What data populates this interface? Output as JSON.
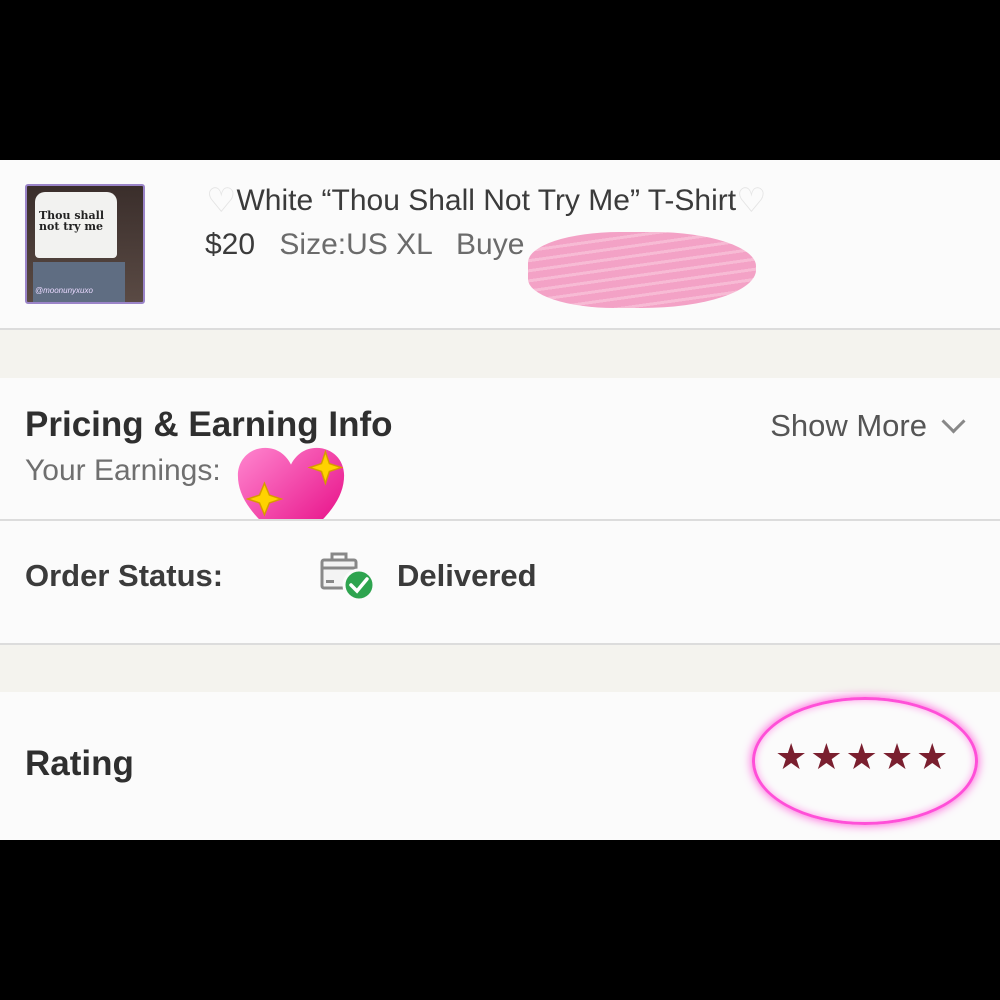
{
  "product": {
    "title": "White “Thou Shall Not Try Me” T-Shirt",
    "title_left_icon": "white-heart-icon",
    "title_right_icon": "white-heart-icon",
    "price": "$20",
    "size": "Size:US XL",
    "buyer_label": "Buye",
    "thumbnail_text": "Thou shall not try me",
    "thumbnail_handle": "@moonunyxuxo"
  },
  "pricing": {
    "title": "Pricing & Earning Info",
    "earnings_label": "Your Earnings:",
    "show_more": "Show More"
  },
  "order_status": {
    "label": "Order Status:",
    "value": "Delivered",
    "icon": "delivered-box-check-icon"
  },
  "rating": {
    "label": "Rating",
    "stars": "★★★★★",
    "value": 5,
    "max": 5
  },
  "colors": {
    "panel_bg": "#fbfbfb",
    "section_gap": "#f4f3ee",
    "star_color": "#7a1f2f",
    "circle_highlight": "#ff4fd8",
    "check_green": "#2ea44f"
  }
}
